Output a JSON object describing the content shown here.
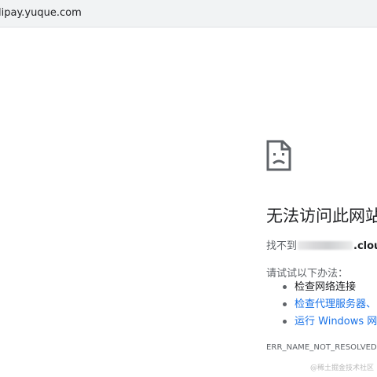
{
  "address_bar": {
    "url": "lipay.yuque.com"
  },
  "error_page": {
    "icon": "sad-page-icon",
    "title": "无法访问此网站",
    "subtitle_prefix": "找不到",
    "subtitle_suffix": ".cloud",
    "try_label": "请试试以下办法：",
    "suggestions": [
      {
        "label": "检查网络连接",
        "is_link": false
      },
      {
        "label": "检查代理服务器、",
        "is_link": true
      },
      {
        "label": "运行 Windows 网络",
        "is_link": true
      }
    ],
    "error_code": "ERR_NAME_NOT_RESOLVED"
  },
  "watermark": "@稀土掘金技术社区",
  "colors": {
    "link": "#1a73e8",
    "text": "#202124",
    "secondary_text": "#5f6368",
    "toolbar": "#f1f3f4"
  }
}
